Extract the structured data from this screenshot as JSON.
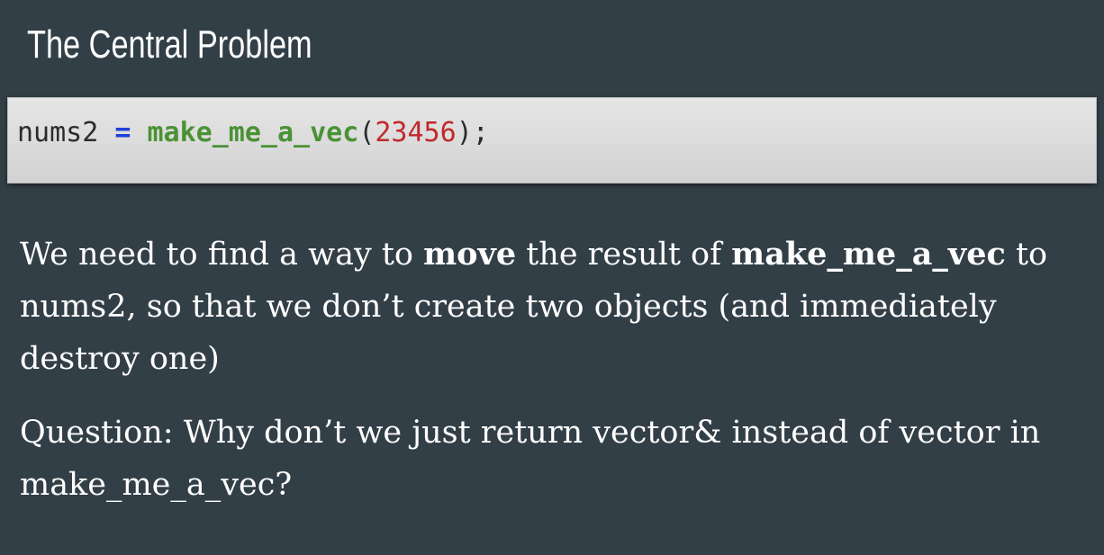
{
  "slide": {
    "title": "The Central Problem"
  },
  "code": {
    "var": "nums2",
    "op": "=",
    "fn": "make_me_a_vec",
    "open_paren": "(",
    "arg": "23456",
    "close": ");"
  },
  "paragraph1": {
    "part1": "We need to find a way to ",
    "bold1": "move",
    "part2": " the result of ",
    "bold2": "make_me_a_vec",
    "part3": " to nums2, so that we don’t create two objects (and immediately destroy one)"
  },
  "paragraph2": {
    "text": "Question: Why don’t we just return vector& instead of vector in make_me_a_vec?"
  }
}
